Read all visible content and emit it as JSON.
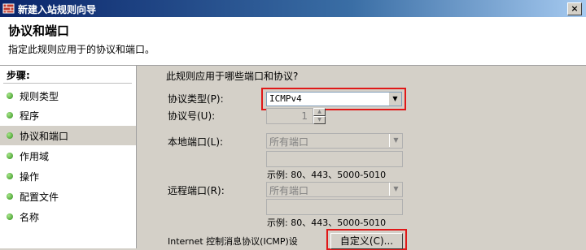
{
  "window": {
    "title": "新建入站规则向导",
    "close_glyph": "×"
  },
  "header": {
    "title": "协议和端口",
    "subtitle": "指定此规则应用于的协议和端口。"
  },
  "sidebar": {
    "title": "步骤:",
    "items": [
      {
        "label": "规则类型"
      },
      {
        "label": "程序"
      },
      {
        "label": "协议和端口",
        "active": true
      },
      {
        "label": "作用域"
      },
      {
        "label": "操作"
      },
      {
        "label": "配置文件"
      },
      {
        "label": "名称"
      }
    ]
  },
  "main": {
    "question": "此规则应用于哪些端口和协议?",
    "protocol_type": {
      "label": "协议类型(P):",
      "value": "ICMPv4"
    },
    "protocol_number": {
      "label": "协议号(U):",
      "value": "1"
    },
    "local_port": {
      "label": "本地端口(L):",
      "value": "所有端口",
      "example": "示例: 80、443、5000-5010"
    },
    "remote_port": {
      "label": "远程端口(R):",
      "value": "所有端口",
      "example": "示例: 80、443、5000-5010"
    },
    "icmp": {
      "label": "Internet 控制消息协议(ICMP)设",
      "button": "自定义(C)..."
    }
  },
  "colors": {
    "highlight": "#e01818",
    "title_bar": "#0a246a",
    "face": "#d4d0c8"
  }
}
